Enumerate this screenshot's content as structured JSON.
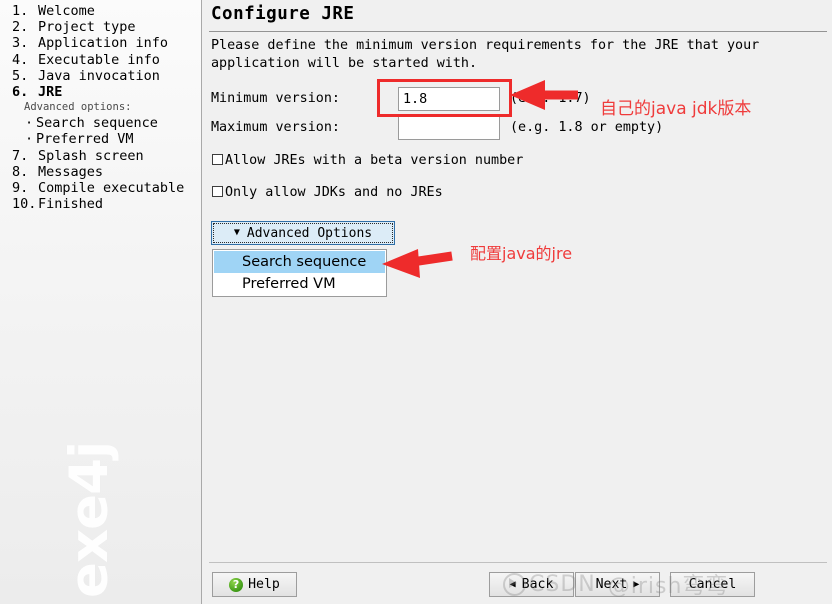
{
  "sidebar": {
    "steps": [
      {
        "num": "1.",
        "label": "Welcome",
        "current": false
      },
      {
        "num": "2.",
        "label": "Project type",
        "current": false
      },
      {
        "num": "3.",
        "label": "Application info",
        "current": false
      },
      {
        "num": "4.",
        "label": "Executable info",
        "current": false
      },
      {
        "num": "5.",
        "label": "Java invocation",
        "current": false
      },
      {
        "num": "6.",
        "label": "JRE",
        "current": true
      },
      {
        "num": "7.",
        "label": "Splash screen",
        "current": false
      },
      {
        "num": "8.",
        "label": "Messages",
        "current": false
      },
      {
        "num": "9.",
        "label": "Compile executable",
        "current": false
      },
      {
        "num": "10.",
        "label": "Finished",
        "current": false
      }
    ],
    "advanced_options_label": "Advanced options:",
    "sub_steps": [
      {
        "bullet": "·",
        "label": "Search sequence"
      },
      {
        "bullet": "·",
        "label": "Preferred VM"
      }
    ],
    "watermark": "exe4j"
  },
  "main": {
    "title": "Configure JRE",
    "intro": "Please define the minimum version requirements for the JRE that your application will be started with.",
    "fields": {
      "minimum": {
        "label": "Minimum version:",
        "value": "1.8",
        "placeholder": "",
        "hint": "(e.g. 1.7)"
      },
      "maximum": {
        "label": "Maximum version:",
        "value": "",
        "placeholder": "",
        "hint": "(e.g. 1.8 or empty)"
      }
    },
    "checkboxes": [
      {
        "label": "Allow JREs with a beta version number",
        "checked": false
      },
      {
        "label": "Only allow JDKs and no JREs",
        "checked": false
      }
    ],
    "advanced": {
      "button_label": "Advanced Options",
      "caret": "▼",
      "items": [
        {
          "label": "Search sequence",
          "selected": true
        },
        {
          "label": "Preferred VM",
          "selected": false
        }
      ]
    }
  },
  "annotations": [
    {
      "id": "jdk-version-note",
      "text": "自己的java jdk版本"
    },
    {
      "id": "jre-config-note",
      "text": "配置java的jre"
    }
  ],
  "footer": {
    "help_label": "Help",
    "help_icon_glyph": "?",
    "back_label": "Back",
    "back_arrow": "◀",
    "next_label": "Next",
    "next_arrow": "▶",
    "cancel_label": "Cancel"
  },
  "watermark": {
    "brand": "CSDN",
    "handle": "@irish弯弯"
  },
  "colors": {
    "annotation_red": "#ef3b3b",
    "selection_blue": "#9fd4f5",
    "panel_bg": "#f0f0f0",
    "help_green": "#3f9a18"
  }
}
